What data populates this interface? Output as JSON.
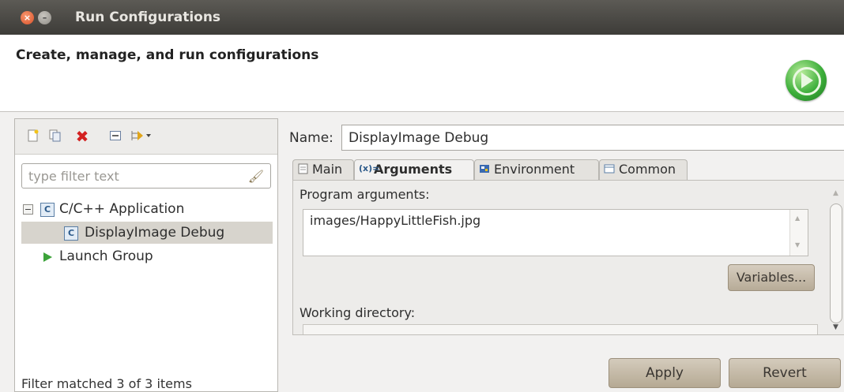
{
  "window": {
    "title": "Run Configurations",
    "close_glyph": "×",
    "minimize_glyph": "–"
  },
  "header": {
    "heading": "Create, manage, and run configurations",
    "logo_icon": "run-icon"
  },
  "left_panel": {
    "toolbar_icons": [
      "new-config-icon",
      "duplicate-icon",
      "delete-icon",
      "collapse-all-icon",
      "filter-icon"
    ],
    "filter": {
      "placeholder": "type filter text",
      "value": ""
    },
    "tree": {
      "cpp_app": {
        "label": "C/C++ Application",
        "icon": "c-app-icon",
        "expanded": true
      },
      "display_debug": {
        "label": "DisplayImage Debug",
        "icon": "c-app-icon",
        "selected": true
      },
      "launch_group": {
        "label": "Launch Group",
        "icon": "launch-group-icon"
      }
    },
    "status": "Filter matched 3 of 3 items"
  },
  "right_panel": {
    "name_label": "Name:",
    "name_value": "DisplayImage Debug",
    "tabs": {
      "main": "Main",
      "arguments": "Arguments",
      "environment": "Environment",
      "common": "Common"
    },
    "active_tab": "arguments",
    "program_arguments_label": "Program arguments:",
    "program_arguments_value": "images/HappyLittleFish.jpg",
    "variables_label": "Variables...",
    "working_directory_label": "Working directory:",
    "apply_label": "Apply",
    "revert_label": "Revert"
  },
  "colors": {
    "titlebar": "#3d3c38",
    "selection": "#d7d4cd",
    "button": "#c7bca9",
    "run_green": "#3cae3a"
  }
}
